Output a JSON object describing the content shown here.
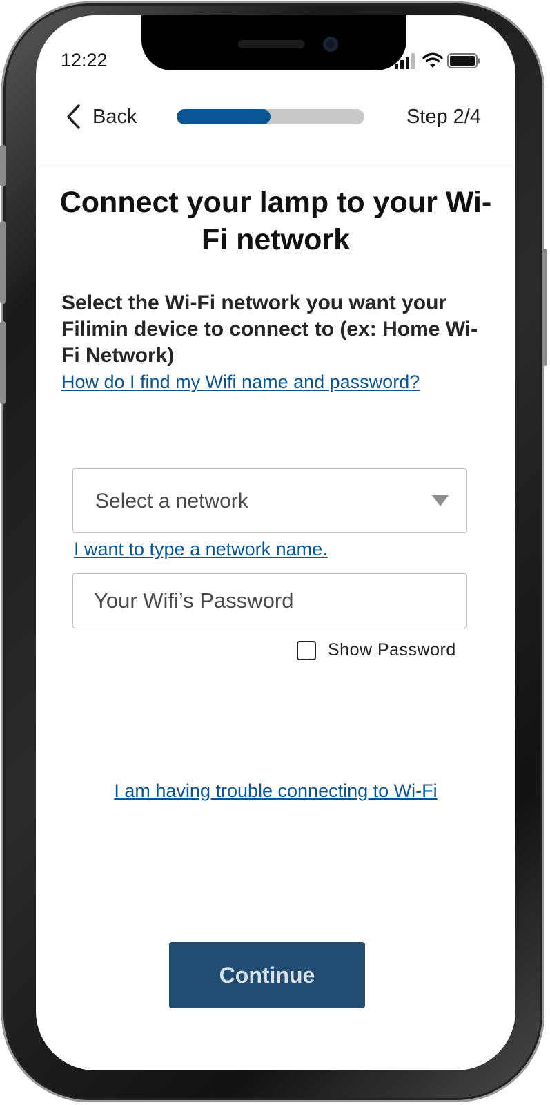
{
  "status_bar": {
    "time": "12:22",
    "icons": [
      "signal-icon",
      "wifi-icon",
      "battery-icon"
    ]
  },
  "header": {
    "back_label": "Back",
    "step_label": "Step 2/4",
    "progress_fraction": 0.5,
    "progress_color": "#0a5594"
  },
  "main": {
    "title": "Connect your lamp to your Wi-Fi network",
    "instructions": "Select the Wi-Fi network you want your Filimin device to connect to (ex: Home Wi-Fi Network)",
    "help_link": "How do I find my Wifi name and password?"
  },
  "form": {
    "network_select_placeholder": "Select a network",
    "type_network_link": "I want to type a network name.",
    "password_placeholder": "Your Wifi’s Password",
    "password_value": "",
    "show_password_label": "Show Password",
    "show_password_checked": false
  },
  "footer": {
    "trouble_link": "I am having trouble connecting to Wi-Fi",
    "continue_label": "Continue",
    "continue_color": "#214d73"
  }
}
